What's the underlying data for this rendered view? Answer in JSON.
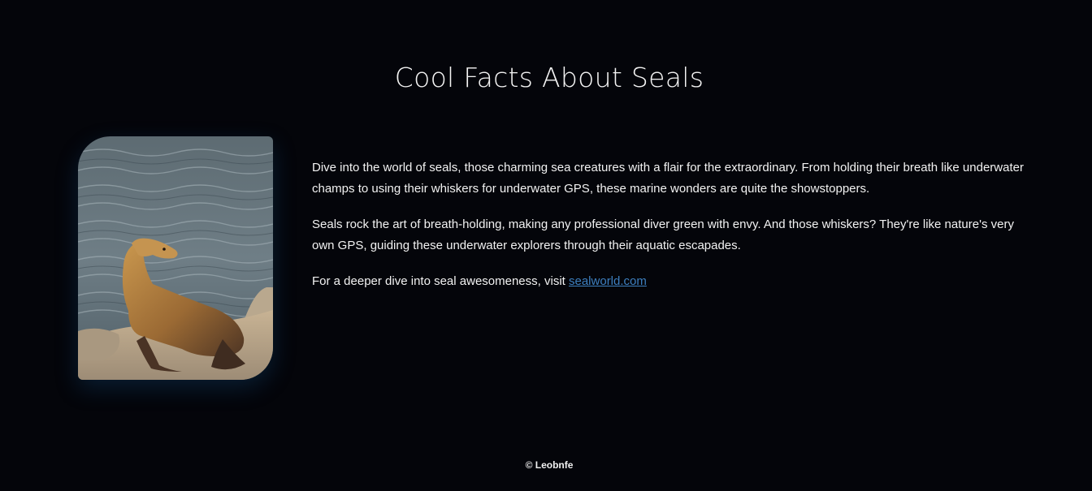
{
  "header": {
    "title": "Cool Facts About Seals"
  },
  "image": {
    "subject": "sea lion sitting on a rock by the water"
  },
  "main": {
    "paragraphs": [
      "Dive into the world of seals, those charming sea creatures with a flair for the extraordinary. From holding their breath like underwater champs to using their whiskers for underwater GPS, these marine wonders are quite the showstoppers.",
      "Seals rock the art of breath-holding, making any professional diver green with envy. And those whiskers? They're like nature's very own GPS, guiding these underwater explorers through their aquatic escapades."
    ],
    "link_prefix": "For a deeper dive into seal awesomeness, visit ",
    "link_text": "sealworld.com"
  },
  "footer": {
    "text": "© Leobnfe"
  },
  "colors": {
    "background": "#04050a",
    "text": "#f2f2f2",
    "link": "#3d7fbf"
  }
}
